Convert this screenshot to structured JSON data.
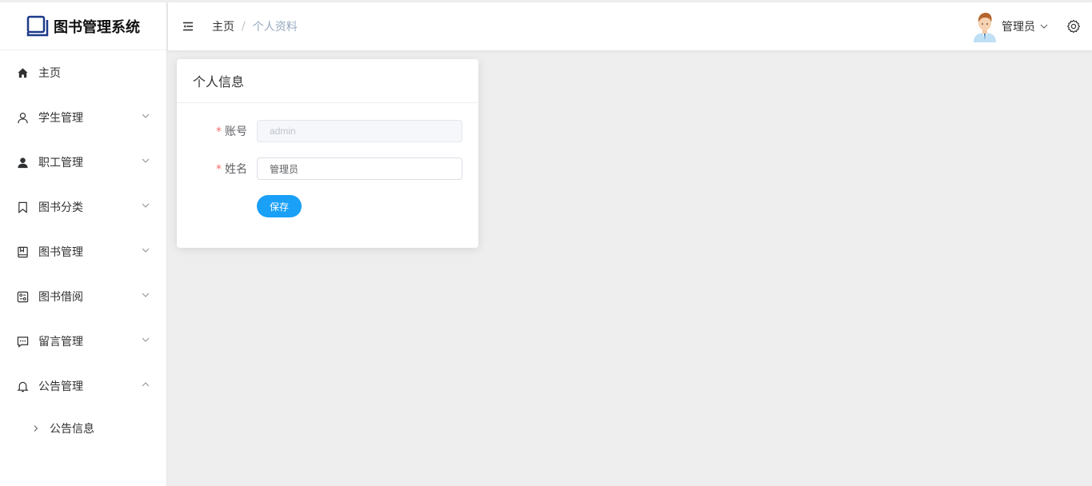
{
  "brand": {
    "title": "图书管理系统",
    "icon": "book-icon"
  },
  "sidebar": {
    "items": [
      {
        "label": "主页",
        "icon": "home-icon",
        "expandable": false
      },
      {
        "label": "学生管理",
        "icon": "user-outline-icon",
        "expandable": true,
        "expanded": false
      },
      {
        "label": "职工管理",
        "icon": "user-filled-icon",
        "expandable": true,
        "expanded": false
      },
      {
        "label": "图书分类",
        "icon": "bookmark-icon",
        "expandable": true,
        "expanded": false
      },
      {
        "label": "图书管理",
        "icon": "notebook-icon",
        "expandable": true,
        "expanded": false
      },
      {
        "label": "图书借阅",
        "icon": "tickets-icon",
        "expandable": true,
        "expanded": false
      },
      {
        "label": "留言管理",
        "icon": "chat-icon",
        "expandable": true,
        "expanded": false
      },
      {
        "label": "公告管理",
        "icon": "bell-icon",
        "expandable": true,
        "expanded": true
      }
    ],
    "subitems": [
      {
        "label": "公告信息"
      }
    ]
  },
  "topbar": {
    "breadcrumb": {
      "home": "主页",
      "separator": "/",
      "current": "个人资料"
    },
    "user": {
      "name": "管理员"
    }
  },
  "card": {
    "title": "个人信息",
    "fields": {
      "account": {
        "label": "账号",
        "value": "admin",
        "disabled": true
      },
      "name": {
        "label": "姓名",
        "value": "管理员"
      }
    },
    "save_label": "保存"
  },
  "colors": {
    "primary": "#1aa0f7",
    "required": "#f56c6c",
    "breadcrumb_current": "#97a8be",
    "page_bg": "#eeeeee"
  }
}
